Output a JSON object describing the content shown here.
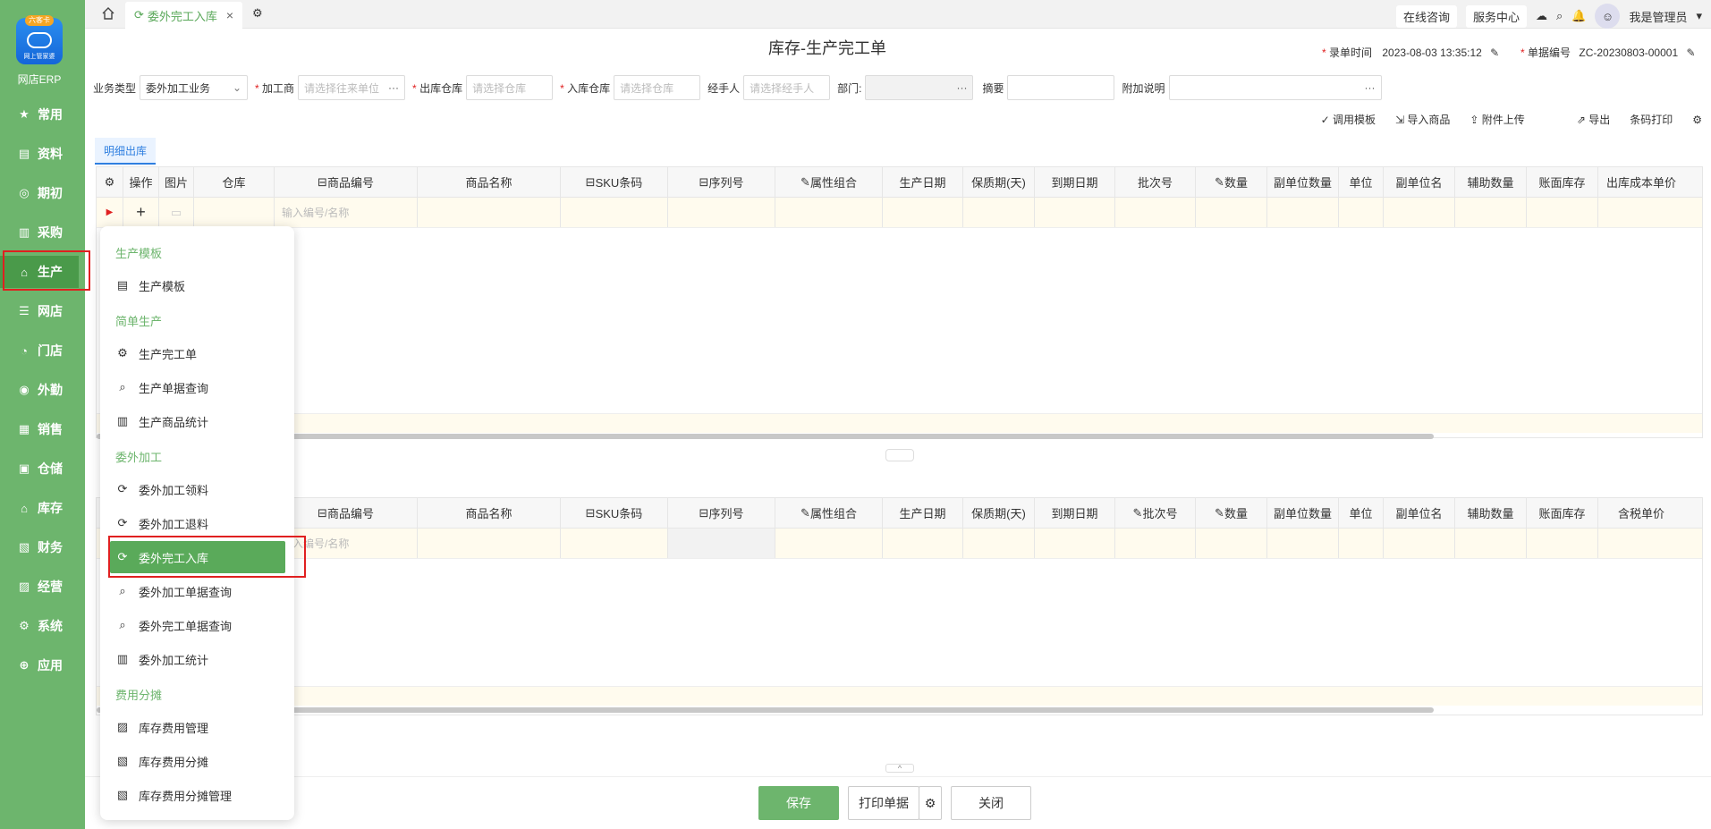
{
  "sidebar": {
    "logo_badge": "六客卡",
    "logo_sub": "网上管家婆",
    "app_name": "网店ERP",
    "items": [
      {
        "label": "常用",
        "icon": "star-icon"
      },
      {
        "label": "资料",
        "icon": "document-icon"
      },
      {
        "label": "期初",
        "icon": "clock-icon"
      },
      {
        "label": "采购",
        "icon": "cart-icon"
      },
      {
        "label": "生产",
        "icon": "factory-icon"
      },
      {
        "label": "网店",
        "icon": "shop-icon"
      },
      {
        "label": "门店",
        "icon": "pie-icon"
      },
      {
        "label": "外勤",
        "icon": "target-icon"
      },
      {
        "label": "销售",
        "icon": "sales-icon"
      },
      {
        "label": "仓储",
        "icon": "warehouse-icon"
      },
      {
        "label": "库存",
        "icon": "home-icon"
      },
      {
        "label": "财务",
        "icon": "finance-icon"
      },
      {
        "label": "经营",
        "icon": "chart-icon"
      },
      {
        "label": "系统",
        "icon": "gear-icon"
      },
      {
        "label": "应用",
        "icon": "plus-icon"
      }
    ]
  },
  "topbar": {
    "tab_label": "委外完工入库",
    "online": "在线咨询",
    "service": "服务中心",
    "user": "我是管理员"
  },
  "page": {
    "title": "库存-生产完工单",
    "time_label": "录单时间",
    "time_value": "2023-08-03 13:35:12",
    "no_label": "单据编号",
    "no_value": "ZC-20230803-00001"
  },
  "form": {
    "biz_type_label": "业务类型",
    "biz_type_value": "委外加工业务",
    "processor_label": "加工商",
    "processor_ph": "请选择往来单位",
    "out_wh_label": "出库仓库",
    "out_wh_ph": "请选择仓库",
    "in_wh_label": "入库仓库",
    "in_wh_ph": "请选择仓库",
    "handler_label": "经手人",
    "handler_ph": "请选择经手人",
    "dept_label": "部门:",
    "summary_label": "摘要",
    "note_label": "附加说明"
  },
  "tools": {
    "template": "调用模板",
    "import": "导入商品",
    "attach": "附件上传",
    "export": "导出",
    "barcode": "条码打印"
  },
  "detail_tab": "明细出库",
  "grid1": {
    "headers": [
      "操作",
      "图片",
      "仓库",
      "商品编号",
      "商品名称",
      "SKU条码",
      "序列号",
      "属性组合",
      "生产日期",
      "保质期(天)",
      "到期日期",
      "批次号",
      "数量",
      "副单位数量",
      "单位",
      "副单位名",
      "辅助数量",
      "账面库存",
      "出库成本单价"
    ],
    "hint": "输入编号/名称"
  },
  "grid2": {
    "headers": [
      "商品编号",
      "商品名称",
      "SKU条码",
      "序列号",
      "属性组合",
      "生产日期",
      "保质期(天)",
      "到期日期",
      "批次号",
      "数量",
      "副单位数量",
      "单位",
      "副单位名",
      "辅助数量",
      "账面库存",
      "含税单价"
    ],
    "hint": "输入编号/名称"
  },
  "buttons": {
    "save": "保存",
    "print": "打印单据",
    "close": "关闭"
  },
  "menu": {
    "g1": "生产模板",
    "i1": "生产模板",
    "g2": "简单生产",
    "i2": "生产完工单",
    "i3": "生产单据查询",
    "i4": "生产商品统计",
    "g3": "委外加工",
    "i5": "委外加工领料",
    "i6": "委外加工退料",
    "i7": "委外完工入库",
    "i8": "委外加工单据查询",
    "i9": "委外完工单据查询",
    "i10": "委外加工统计",
    "g4": "费用分摊",
    "i11": "库存费用管理",
    "i12": "库存费用分摊",
    "i13": "库存费用分摊管理"
  }
}
